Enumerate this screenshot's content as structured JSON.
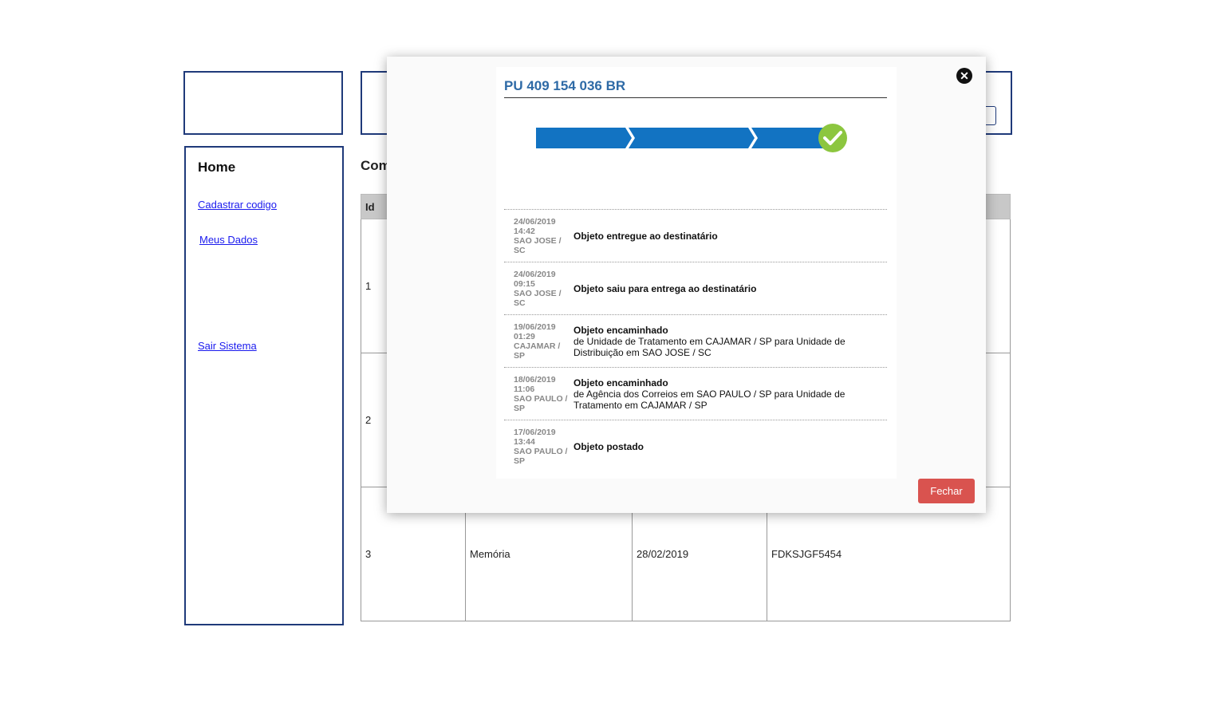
{
  "sidebar": {
    "title": "Home",
    "links": {
      "cadastrar": "Cadastrar codigo",
      "meus_dados": "Meus Dados",
      "sair": "Sair Sistema"
    }
  },
  "main": {
    "title_partial": "Com"
  },
  "table": {
    "header_id": "Id",
    "rows": [
      {
        "id": "1",
        "name": "",
        "date": "",
        "code": ""
      },
      {
        "id": "2",
        "name": "",
        "date": "",
        "code": ""
      },
      {
        "id": "3",
        "name": "Memória",
        "date": "28/02/2019",
        "code": "FDKSJGF5454"
      }
    ]
  },
  "modal": {
    "close_icon": "close-icon",
    "tracking_code": "PU 409 154 036 BR",
    "progress": {
      "steps": 3,
      "completed": true,
      "color": "#1273c2",
      "check_color": "#8cc63f"
    },
    "events": [
      {
        "date": "24/06/2019",
        "time": "14:42",
        "location": "SAO JOSE / SC",
        "title": "Objeto entregue ao destinatário",
        "detail": ""
      },
      {
        "date": "24/06/2019",
        "time": "09:15",
        "location": "SAO JOSE / SC",
        "title": "Objeto saiu para entrega ao destinatário",
        "detail": ""
      },
      {
        "date": "19/06/2019",
        "time": "01:29",
        "location": "CAJAMAR / SP",
        "title": "Objeto encaminhado",
        "detail": "de Unidade de Tratamento em CAJAMAR / SP para Unidade de Distribuição em SAO JOSE / SC"
      },
      {
        "date": "18/06/2019",
        "time": "11:06",
        "location": "SAO PAULO / SP",
        "title": "Objeto encaminhado",
        "detail": "de Agência dos Correios em SAO PAULO / SP para Unidade de Tratamento em CAJAMAR / SP"
      },
      {
        "date": "17/06/2019",
        "time": "13:44",
        "location": "SAO PAULO / SP",
        "title": "Objeto postado",
        "detail": ""
      }
    ],
    "close_button": "Fechar"
  }
}
